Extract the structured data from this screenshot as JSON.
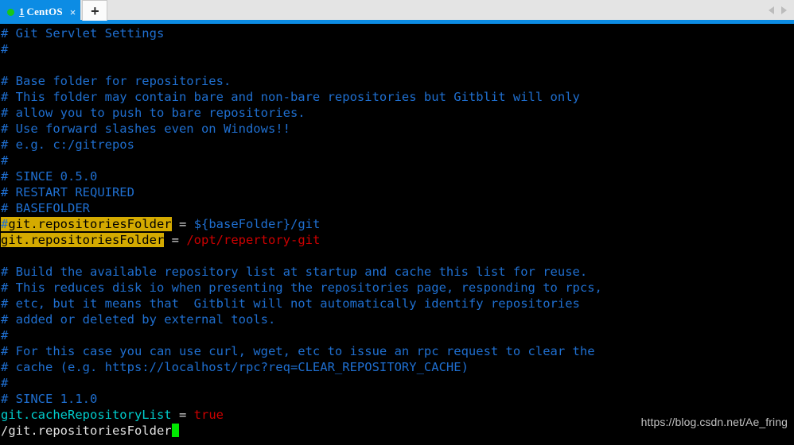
{
  "tabbar": {
    "tab": {
      "index": "1",
      "title": "CentOS",
      "close_label": "×",
      "status_color": "#18c718"
    },
    "new_tab_label": "+",
    "nav_prev_label": "",
    "nav_next_label": ""
  },
  "terminal": {
    "colors": {
      "background": "#000000",
      "comment": "#1f6fd0",
      "key": "#00cdcd",
      "value": "#cd0000",
      "operator": "#d6d6d6",
      "highlight_bg": "#d4aa00",
      "highlight_fg": "#000000",
      "cursor": "#00e800",
      "plain": "#e0e0e0"
    },
    "lines": [
      {
        "id": "l01",
        "segments": [
          {
            "text": "# Git Servlet Settings",
            "style": "comment"
          }
        ]
      },
      {
        "id": "l02",
        "segments": [
          {
            "text": "#",
            "style": "comment"
          }
        ]
      },
      {
        "id": "l03",
        "segments": [
          {
            "text": "",
            "style": "plain"
          }
        ]
      },
      {
        "id": "l04",
        "segments": [
          {
            "text": "# Base folder for repositories.",
            "style": "comment"
          }
        ]
      },
      {
        "id": "l05",
        "segments": [
          {
            "text": "# This folder may contain bare and non-bare repositories but Gitblit will only",
            "style": "comment"
          }
        ]
      },
      {
        "id": "l06",
        "segments": [
          {
            "text": "# allow you to push to bare repositories.",
            "style": "comment"
          }
        ]
      },
      {
        "id": "l07",
        "segments": [
          {
            "text": "# Use forward slashes even on Windows!!",
            "style": "comment"
          }
        ]
      },
      {
        "id": "l08",
        "segments": [
          {
            "text": "# e.g. c:/gitrepos",
            "style": "comment"
          }
        ]
      },
      {
        "id": "l09",
        "segments": [
          {
            "text": "#",
            "style": "comment"
          }
        ]
      },
      {
        "id": "l10",
        "segments": [
          {
            "text": "# SINCE 0.5.0",
            "style": "comment"
          }
        ]
      },
      {
        "id": "l11",
        "segments": [
          {
            "text": "# RESTART REQUIRED",
            "style": "comment"
          }
        ]
      },
      {
        "id": "l12",
        "segments": [
          {
            "text": "# BASEFOLDER",
            "style": "comment"
          }
        ]
      },
      {
        "id": "l13",
        "segments": [
          {
            "text": "#",
            "style": "highlight-hash"
          },
          {
            "text": "git.repositoriesFolder",
            "style": "highlight"
          },
          {
            "text": " ",
            "style": "plain"
          },
          {
            "text": "=",
            "style": "operator"
          },
          {
            "text": " ",
            "style": "plain"
          },
          {
            "text": "${baseFolder}/git",
            "style": "comment"
          }
        ]
      },
      {
        "id": "l14",
        "segments": [
          {
            "text": "git.repositoriesFolder",
            "style": "highlight"
          },
          {
            "text": " ",
            "style": "plain"
          },
          {
            "text": "=",
            "style": "operator"
          },
          {
            "text": " ",
            "style": "plain"
          },
          {
            "text": "/opt/repertory-git",
            "style": "value"
          }
        ]
      },
      {
        "id": "l15",
        "segments": [
          {
            "text": "",
            "style": "plain"
          }
        ]
      },
      {
        "id": "l16",
        "segments": [
          {
            "text": "# Build the available repository list at startup and cache this list for reuse.",
            "style": "comment"
          }
        ]
      },
      {
        "id": "l17",
        "segments": [
          {
            "text": "# This reduces disk io when presenting the repositories page, responding to rpcs,",
            "style": "comment"
          }
        ]
      },
      {
        "id": "l18",
        "segments": [
          {
            "text": "# etc, but it means that  Gitblit will not automatically identify repositories",
            "style": "comment"
          }
        ]
      },
      {
        "id": "l19",
        "segments": [
          {
            "text": "# added or deleted by external tools.",
            "style": "comment"
          }
        ]
      },
      {
        "id": "l20",
        "segments": [
          {
            "text": "#",
            "style": "comment"
          }
        ]
      },
      {
        "id": "l21",
        "segments": [
          {
            "text": "# For this case you can use curl, wget, etc to issue an rpc request to clear the",
            "style": "comment"
          }
        ]
      },
      {
        "id": "l22",
        "segments": [
          {
            "text": "# cache (e.g. https://localhost/rpc?req=CLEAR_REPOSITORY_CACHE)",
            "style": "comment"
          }
        ]
      },
      {
        "id": "l23",
        "segments": [
          {
            "text": "#",
            "style": "comment"
          }
        ]
      },
      {
        "id": "l24",
        "segments": [
          {
            "text": "# SINCE 1.1.0",
            "style": "comment"
          }
        ]
      },
      {
        "id": "l25",
        "segments": [
          {
            "text": "git.cacheRepositoryList",
            "style": "key"
          },
          {
            "text": " ",
            "style": "plain"
          },
          {
            "text": "=",
            "style": "operator"
          },
          {
            "text": " ",
            "style": "plain"
          },
          {
            "text": "true",
            "style": "value"
          }
        ]
      },
      {
        "id": "l26",
        "segments": [
          {
            "text": "/git.repositoriesFolder",
            "style": "plain"
          },
          {
            "text": "",
            "style": "cursor"
          }
        ]
      }
    ]
  },
  "watermark": {
    "text": "https://blog.csdn.net/Ae_fring"
  }
}
